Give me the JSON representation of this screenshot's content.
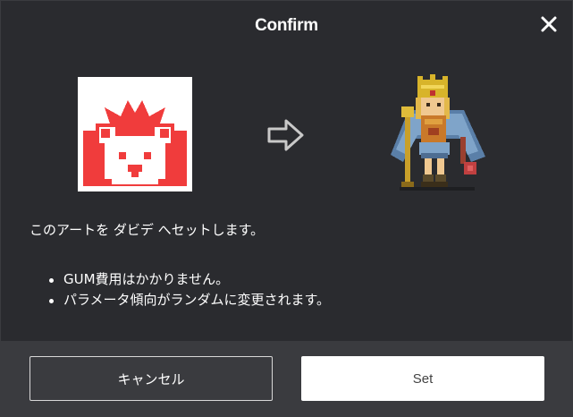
{
  "dialog": {
    "title": "Confirm",
    "close_icon": "close-icon"
  },
  "art": {
    "source_icon": "lion-art-icon",
    "arrow_icon": "arrow-right-icon",
    "target_icon": "pixel-king-character-icon",
    "accent_color": "#f03c3c"
  },
  "message": "このアートを ダビデ へセットします。",
  "notes": [
    "GUM費用はかかりません。",
    "パラメータ傾向がランダムに変更されます。"
  ],
  "buttons": {
    "cancel_label": "キャンセル",
    "set_label": "Set"
  }
}
